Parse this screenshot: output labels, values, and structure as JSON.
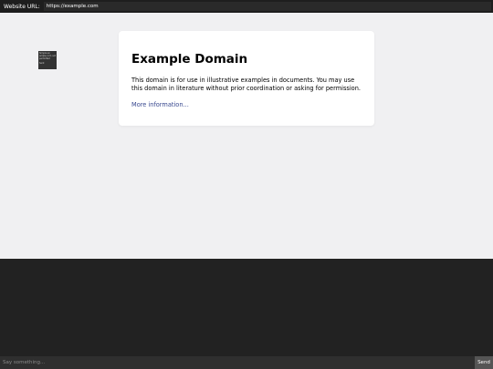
{
  "topbar": {
    "label": "Website URL:",
    "url": "https://example.com"
  },
  "page": {
    "title": "Example Domain",
    "body": "This domain is for use in illustrative examples in documents. You may use this domain in literature without prior coordination or asking for permission.",
    "link": "More information..."
  },
  "overlay": {
    "lines": [
      "Simple ex",
      "ample.com not",
      "permitted",
      "Sent"
    ]
  },
  "chat": {
    "placeholder": "Say something...",
    "send_label": "Send"
  }
}
